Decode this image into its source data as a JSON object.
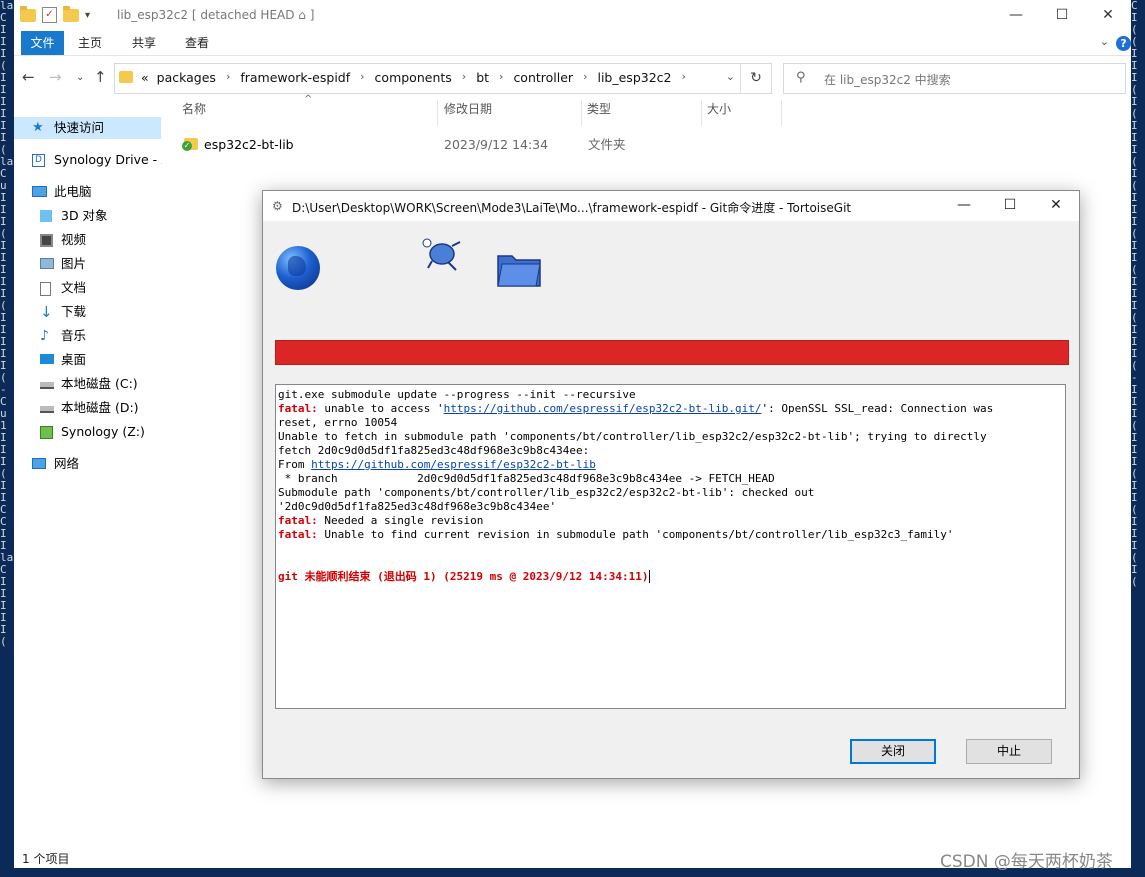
{
  "window": {
    "title": "lib_esp32c2 [ detached HEAD ⌂ ]",
    "minimize": "—",
    "maximize": "☐",
    "close": "✕"
  },
  "ribbon": {
    "tabs": [
      "文件",
      "主页",
      "共享",
      "查看"
    ],
    "help": "?"
  },
  "address": {
    "prefix": "«",
    "crumbs": [
      "packages",
      "framework-espidf",
      "components",
      "bt",
      "controller",
      "lib_esp32c2"
    ],
    "search_placeholder": "在 lib_esp32c2 中搜索"
  },
  "sidebar": {
    "items": [
      {
        "label": "快速访问",
        "icon": "star-icon"
      },
      {
        "label": "Synology Drive - X",
        "icon": "synology-drive-icon"
      },
      {
        "label": "此电脑",
        "icon": "computer-icon"
      },
      {
        "label": "3D 对象",
        "icon": "cube-icon"
      },
      {
        "label": "视频",
        "icon": "video-icon"
      },
      {
        "label": "图片",
        "icon": "picture-icon"
      },
      {
        "label": "文档",
        "icon": "document-icon"
      },
      {
        "label": "下载",
        "icon": "download-icon"
      },
      {
        "label": "音乐",
        "icon": "music-icon"
      },
      {
        "label": "桌面",
        "icon": "desktop-icon"
      },
      {
        "label": "本地磁盘 (C:)",
        "icon": "drive-icon"
      },
      {
        "label": "本地磁盘 (D:)",
        "icon": "drive-icon"
      },
      {
        "label": "Synology (Z:)",
        "icon": "network-drive-icon"
      },
      {
        "label": "网络",
        "icon": "network-icon"
      }
    ]
  },
  "columns": [
    "名称",
    "修改日期",
    "类型",
    "大小"
  ],
  "files": [
    {
      "name": "esp32c2-bt-lib",
      "date": "2023/9/12 14:34",
      "type": "文件夹",
      "size": ""
    }
  ],
  "status": "1 个项目",
  "dialog": {
    "title": "D:\\User\\Desktop\\WORK\\Screen\\Mode3\\LaiTe\\Mo...\\framework-espidf - Git命令进度 - TortoiseGit",
    "progress_color": "#dc2626",
    "log": {
      "l1": "git.exe submodule update --progress --init --recursive",
      "fatal": "fatal:",
      "l2a": " unable to access '",
      "l2link": "https://github.com/espressif/esp32c2-bt-lib.git/",
      "l2b": "': OpenSSL SSL_read: Connection was",
      "l3": "reset, errno 10054",
      "l4": "Unable to fetch in submodule path 'components/bt/controller/lib_esp32c2/esp32c2-bt-lib'; trying to directly",
      "l5": "fetch 2d0c9d0d5df1fa825ed3c48df968e3c9b8c434ee:",
      "l6a": "From ",
      "l6link": "https://github.com/espressif/esp32c2-bt-lib",
      "l7": " * branch            2d0c9d0d5df1fa825ed3c48df968e3c9b8c434ee -> FETCH_HEAD",
      "l8": "Submodule path 'components/bt/controller/lib_esp32c2/esp32c2-bt-lib': checked out",
      "l9": "'2d0c9d0d5df1fa825ed3c48df968e3c9b8c434ee'",
      "l10": " Needed a single revision",
      "l11": " Unable to find current revision in submodule path 'components/bt/controller/lib_esp32c3_family'",
      "result": "git 未能顺利结束 (退出码 1) (25219 ms @ 2023/9/12 14:34:11)"
    },
    "close_button": "关闭",
    "abort_button": "中止"
  },
  "watermark": "CSDN @每天两杯奶茶"
}
